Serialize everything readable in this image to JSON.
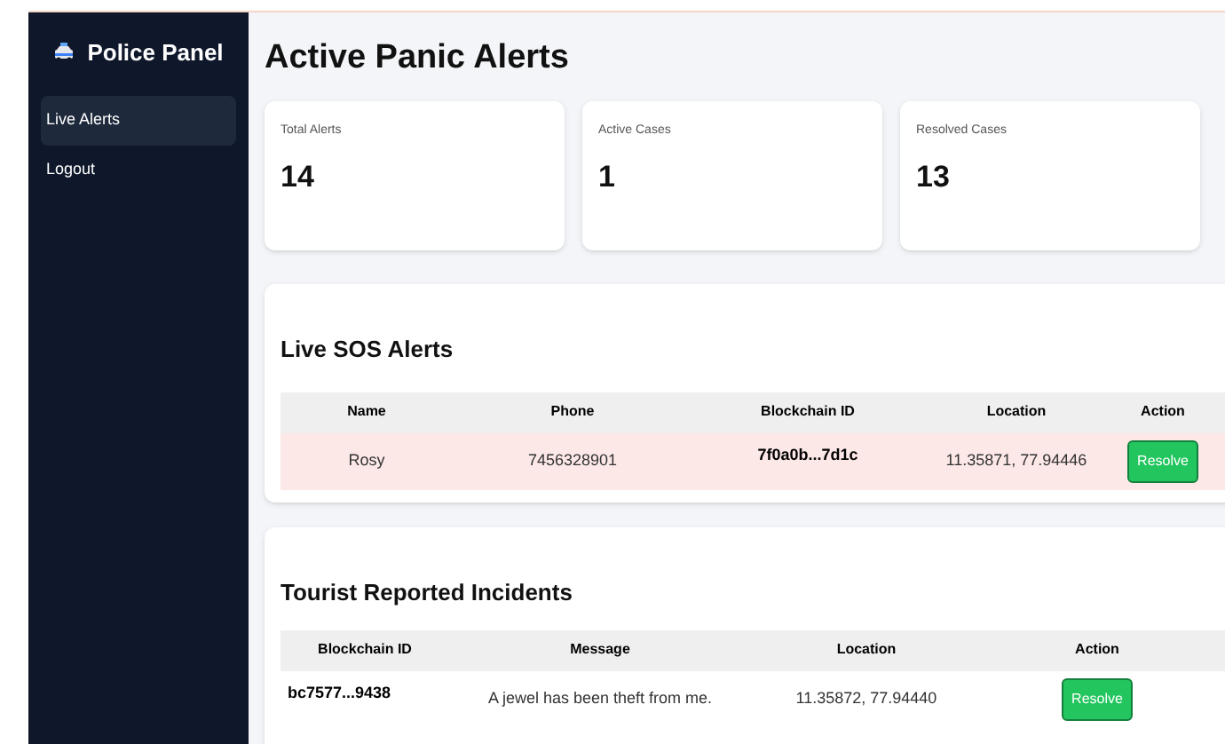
{
  "sidebar": {
    "title": "Police Panel",
    "items": [
      {
        "label": "Live Alerts",
        "selected": true
      },
      {
        "label": "Logout",
        "selected": false
      }
    ]
  },
  "page_title": "Active Panic Alerts",
  "stats": [
    {
      "label": "Total Alerts",
      "value": "14"
    },
    {
      "label": "Active Cases",
      "value": "1"
    },
    {
      "label": "Resolved Cases",
      "value": "13"
    }
  ],
  "sos": {
    "title": "Live SOS Alerts",
    "columns": [
      "Name",
      "Phone",
      "Blockchain ID",
      "Location",
      "Action"
    ],
    "rows": [
      {
        "name": "Rosy",
        "phone": "7456328901",
        "blockchain_id": "7f0a0b...7d1c",
        "location": "11.35871, 77.94446",
        "action": "Resolve",
        "highlighted": true
      }
    ]
  },
  "incidents": {
    "title": "Tourist Reported Incidents",
    "columns": [
      "Blockchain ID",
      "Message",
      "Location",
      "Action"
    ],
    "rows": [
      {
        "blockchain_id": "bc7577...9438",
        "message": "A jewel has been theft from me.",
        "location": "11.35872, 77.94440",
        "action": "Resolve"
      }
    ]
  }
}
